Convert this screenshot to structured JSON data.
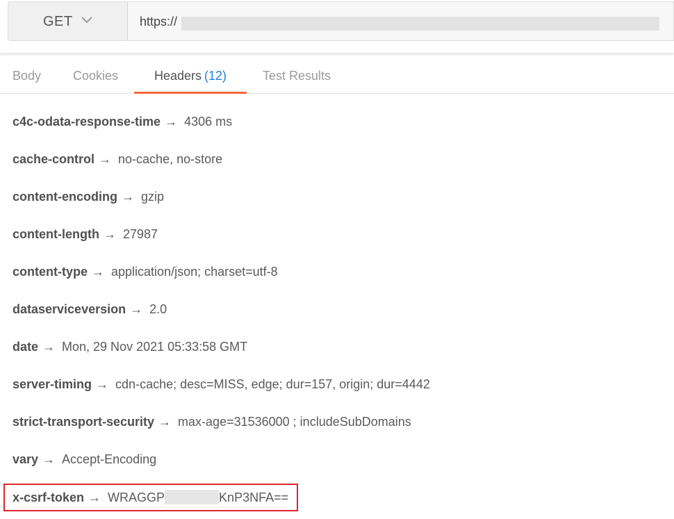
{
  "request": {
    "method": "GET",
    "url_prefix": "https://"
  },
  "tabs": [
    {
      "label": "Body"
    },
    {
      "label": "Cookies"
    },
    {
      "label": "Headers",
      "count": "(12)"
    },
    {
      "label": "Test Results"
    }
  ],
  "headers": [
    {
      "key": "c4c-odata-response-time",
      "arrow": "→",
      "value": "4306 ms"
    },
    {
      "key": "cache-control",
      "arrow": "→",
      "value": "no-cache, no-store"
    },
    {
      "key": "content-encoding",
      "arrow": "→",
      "value": "gzip"
    },
    {
      "key": "content-length",
      "arrow": "→",
      "value": "27987"
    },
    {
      "key": "content-type",
      "arrow": "→",
      "value": "application/json; charset=utf-8"
    },
    {
      "key": "dataserviceversion",
      "arrow": "→",
      "value": "2.0"
    },
    {
      "key": "date",
      "arrow": "→",
      "value": "Mon, 29 Nov 2021 05:33:58 GMT"
    },
    {
      "key": "server-timing",
      "arrow": "→",
      "value": "cdn-cache; desc=MISS, edge; dur=157, origin; dur=4442"
    },
    {
      "key": "strict-transport-security",
      "arrow": "→",
      "value": "max-age=31536000 ; includeSubDomains"
    },
    {
      "key": "vary",
      "arrow": "→",
      "value": "Accept-Encoding"
    },
    {
      "key": "x-csrf-token",
      "arrow": "→",
      "value_start": "WRAGGP",
      "value_end": "KnP3NFA=="
    }
  ],
  "colors": {
    "active_tab_underline": "#f26b3a",
    "count_badge": "#1a7fd4",
    "highlight_border": "#e0242f"
  },
  "icons": {
    "method_dropdown": "chevron-down-icon"
  }
}
